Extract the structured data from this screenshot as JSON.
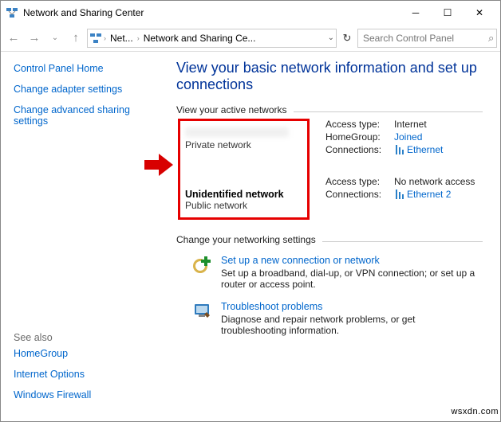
{
  "window": {
    "title": "Network and Sharing Center"
  },
  "breadcrumbs": {
    "b1": "Net...",
    "b2": "Network and Sharing Ce..."
  },
  "search": {
    "placeholder": "Search Control Panel"
  },
  "sidebar": {
    "home": "Control Panel Home",
    "adapter": "Change adapter settings",
    "advanced": "Change advanced sharing settings",
    "see_also": "See also",
    "homegroup": "HomeGroup",
    "internet": "Internet Options",
    "firewall": "Windows Firewall"
  },
  "main": {
    "heading": "View your basic network information and set up connections",
    "active_label": "View your active networks",
    "net1": {
      "type": "Private network",
      "access_type_label": "Access type:",
      "access_type": "Internet",
      "homegroup_label": "HomeGroup:",
      "homegroup": "Joined",
      "conn_label": "Connections:",
      "conn": "Ethernet"
    },
    "net2": {
      "name": "Unidentified network",
      "type": "Public network",
      "access_type_label": "Access type:",
      "access_type": "No network access",
      "conn_label": "Connections:",
      "conn": "Ethernet 2"
    },
    "change_label": "Change your networking settings",
    "setup": {
      "title": "Set up a new connection or network",
      "desc": "Set up a broadband, dial-up, or VPN connection; or set up a router or access point."
    },
    "troubleshoot": {
      "title": "Troubleshoot problems",
      "desc": "Diagnose and repair network problems, or get troubleshooting information."
    }
  },
  "watermark": "wsxdn.com"
}
